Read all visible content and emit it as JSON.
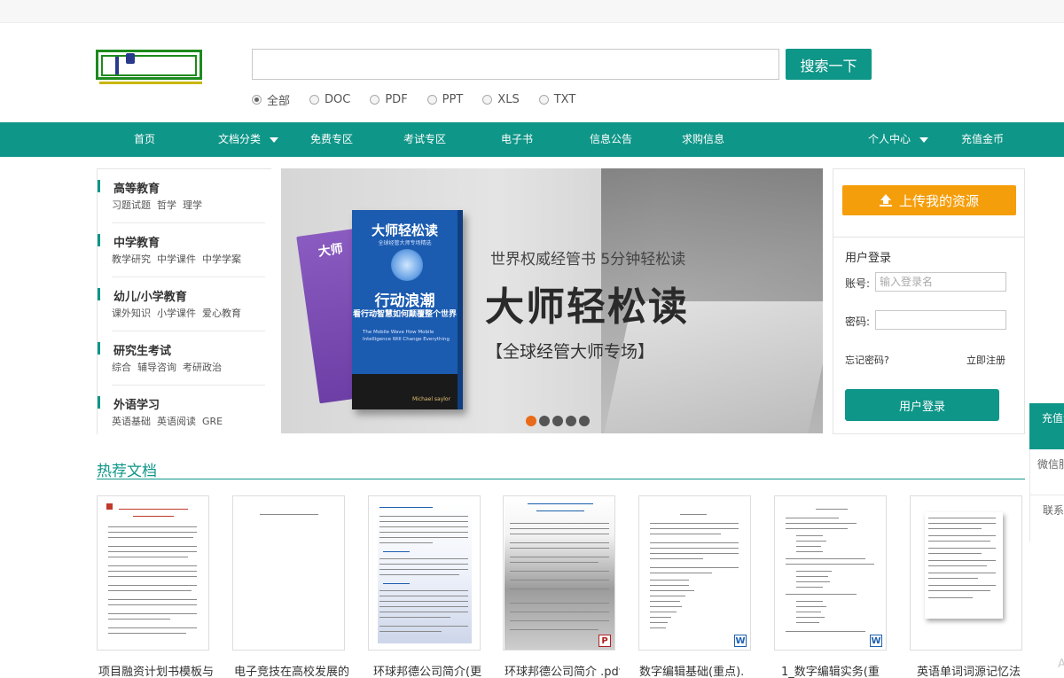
{
  "search": {
    "placeholder": "",
    "button": "搜索一下"
  },
  "filetypes": [
    {
      "label": "全部",
      "selected": true
    },
    {
      "label": "DOC",
      "selected": false
    },
    {
      "label": "PDF",
      "selected": false
    },
    {
      "label": "PPT",
      "selected": false
    },
    {
      "label": "XLS",
      "selected": false
    },
    {
      "label": "TXT",
      "selected": false
    }
  ],
  "nav": [
    {
      "label": "首页"
    },
    {
      "label": "文档分类",
      "dropdown": true
    },
    {
      "label": "免费专区"
    },
    {
      "label": "考试专区"
    },
    {
      "label": "电子书"
    },
    {
      "label": "信息公告"
    },
    {
      "label": "求购信息"
    },
    {
      "label": "个人中心",
      "dropdown": true
    },
    {
      "label": "充值金币"
    }
  ],
  "categories": [
    {
      "title": "高等教育",
      "subs": [
        "习题试题",
        "哲学",
        "理学"
      ]
    },
    {
      "title": "中学教育",
      "subs": [
        "教学研究",
        "中学课件",
        "中学学案"
      ]
    },
    {
      "title": "幼儿/小学教育",
      "subs": [
        "课外知识",
        "小学课件",
        "爱心教育"
      ]
    },
    {
      "title": "研究生考试",
      "subs": [
        "综合",
        "辅导咨询",
        "考研政治"
      ]
    },
    {
      "title": "外语学习",
      "subs": [
        "英语基础",
        "英语阅读",
        "GRE"
      ]
    }
  ],
  "banner": {
    "slogan": "世界权威经管书 5分钟轻松读",
    "headline": "大师轻松读",
    "sub": "【全球经管大师专场】",
    "book_title": "大师轻松读",
    "book_subtitle": "全球经管大师专场精选",
    "book_heading": "行动浪潮",
    "book_heading2": "看行动智慧如何颠覆整个世界",
    "book_en": "The Mobile Wave How Mobile Intelligence Will Change Everything",
    "book_author": "Michael saylor",
    "book_back_title": "大师",
    "dots": 5,
    "active_dot": 0
  },
  "upload": {
    "label": "上传我的资源"
  },
  "login": {
    "title": "用户登录",
    "account_label": "账号:",
    "account_placeholder": "输入登录名",
    "password_label": "密码:",
    "forgot": "忘记密码?",
    "register": "立即注册",
    "button": "用户登录"
  },
  "side": {
    "recharge": "充值金币",
    "wechat": "微信服务号",
    "contact": "联系客服"
  },
  "hot": {
    "title": "热荐文档",
    "docs": [
      {
        "title": "项目融资计划书模板与",
        "badge": ""
      },
      {
        "title": "电子竞技在高校发展的",
        "badge": ""
      },
      {
        "title": "环球邦德公司简介(更",
        "badge": ""
      },
      {
        "title": "环球邦德公司简介 .pdf",
        "badge": "P"
      },
      {
        "title": "数字编辑基础(重点).",
        "badge": "W"
      },
      {
        "title": "1_数字编辑实务(重",
        "badge": "W"
      },
      {
        "title": "英语单词词源记忆法",
        "badge": ""
      }
    ]
  },
  "colors": {
    "accent": "#0e9688",
    "upload": "#f59e0b",
    "active_dot": "#e86a1a"
  }
}
